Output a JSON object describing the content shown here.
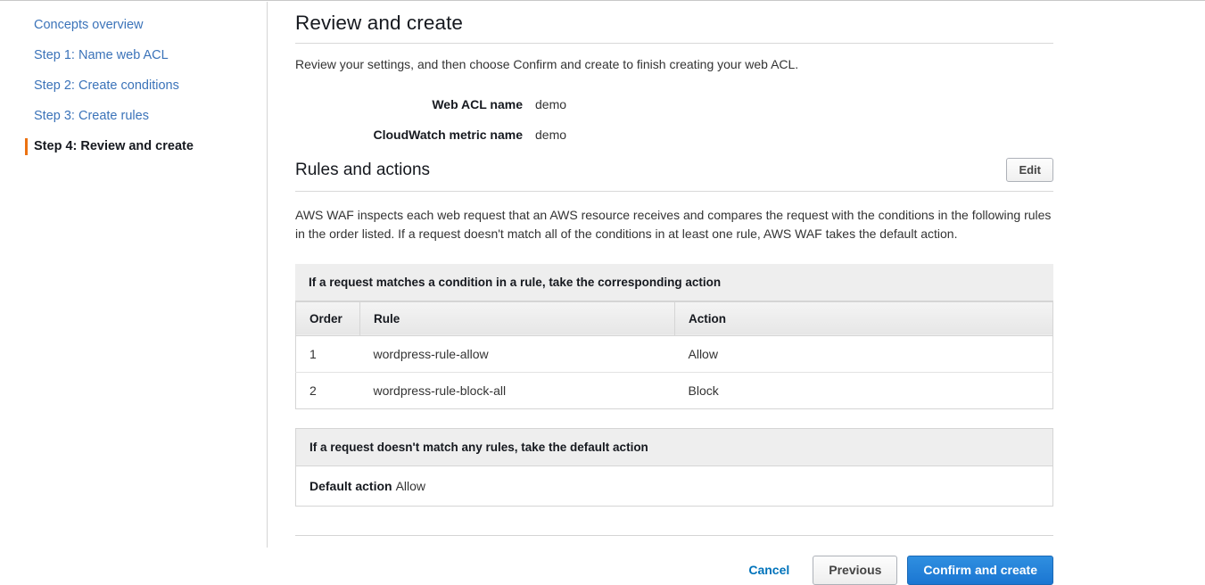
{
  "sidebar": {
    "items": [
      {
        "label": "Concepts overview",
        "active": false
      },
      {
        "label": "Step 1: Name web ACL",
        "active": false
      },
      {
        "label": "Step 2: Create conditions",
        "active": false
      },
      {
        "label": "Step 3: Create rules",
        "active": false
      },
      {
        "label": "Step 4: Review and create",
        "active": true
      }
    ],
    "active_marker_color": "#ec7211",
    "link_color": "#3b73b9"
  },
  "main": {
    "title": "Review and create",
    "intro": "Review your settings, and then choose Confirm and create to finish creating your web ACL.",
    "summary": [
      {
        "label": "Web ACL name",
        "value": "demo"
      },
      {
        "label": "CloudWatch metric name",
        "value": "demo"
      }
    ],
    "rules_section": {
      "heading": "Rules and actions",
      "edit_label": "Edit",
      "description": "AWS WAF inspects each web request that an AWS resource receives and compares the request with the conditions in the following rules in the order listed. If a request doesn't match all of the conditions in at least one rule, AWS WAF takes the default action.",
      "rules_table": {
        "caption": "If a request matches a condition in a rule, take the corresponding action",
        "columns": [
          "Order",
          "Rule",
          "Action"
        ],
        "rows": [
          {
            "order": "1",
            "rule": "wordpress-rule-allow",
            "action": "Allow"
          },
          {
            "order": "2",
            "rule": "wordpress-rule-block-all",
            "action": "Block"
          }
        ]
      },
      "default_table": {
        "caption": "If a request doesn't match any rules, take the default action",
        "label": "Default action",
        "value": "Allow"
      }
    }
  },
  "footer": {
    "cancel_label": "Cancel",
    "previous_label": "Previous",
    "confirm_label": "Confirm and create",
    "primary_color": "#1b76d2"
  }
}
